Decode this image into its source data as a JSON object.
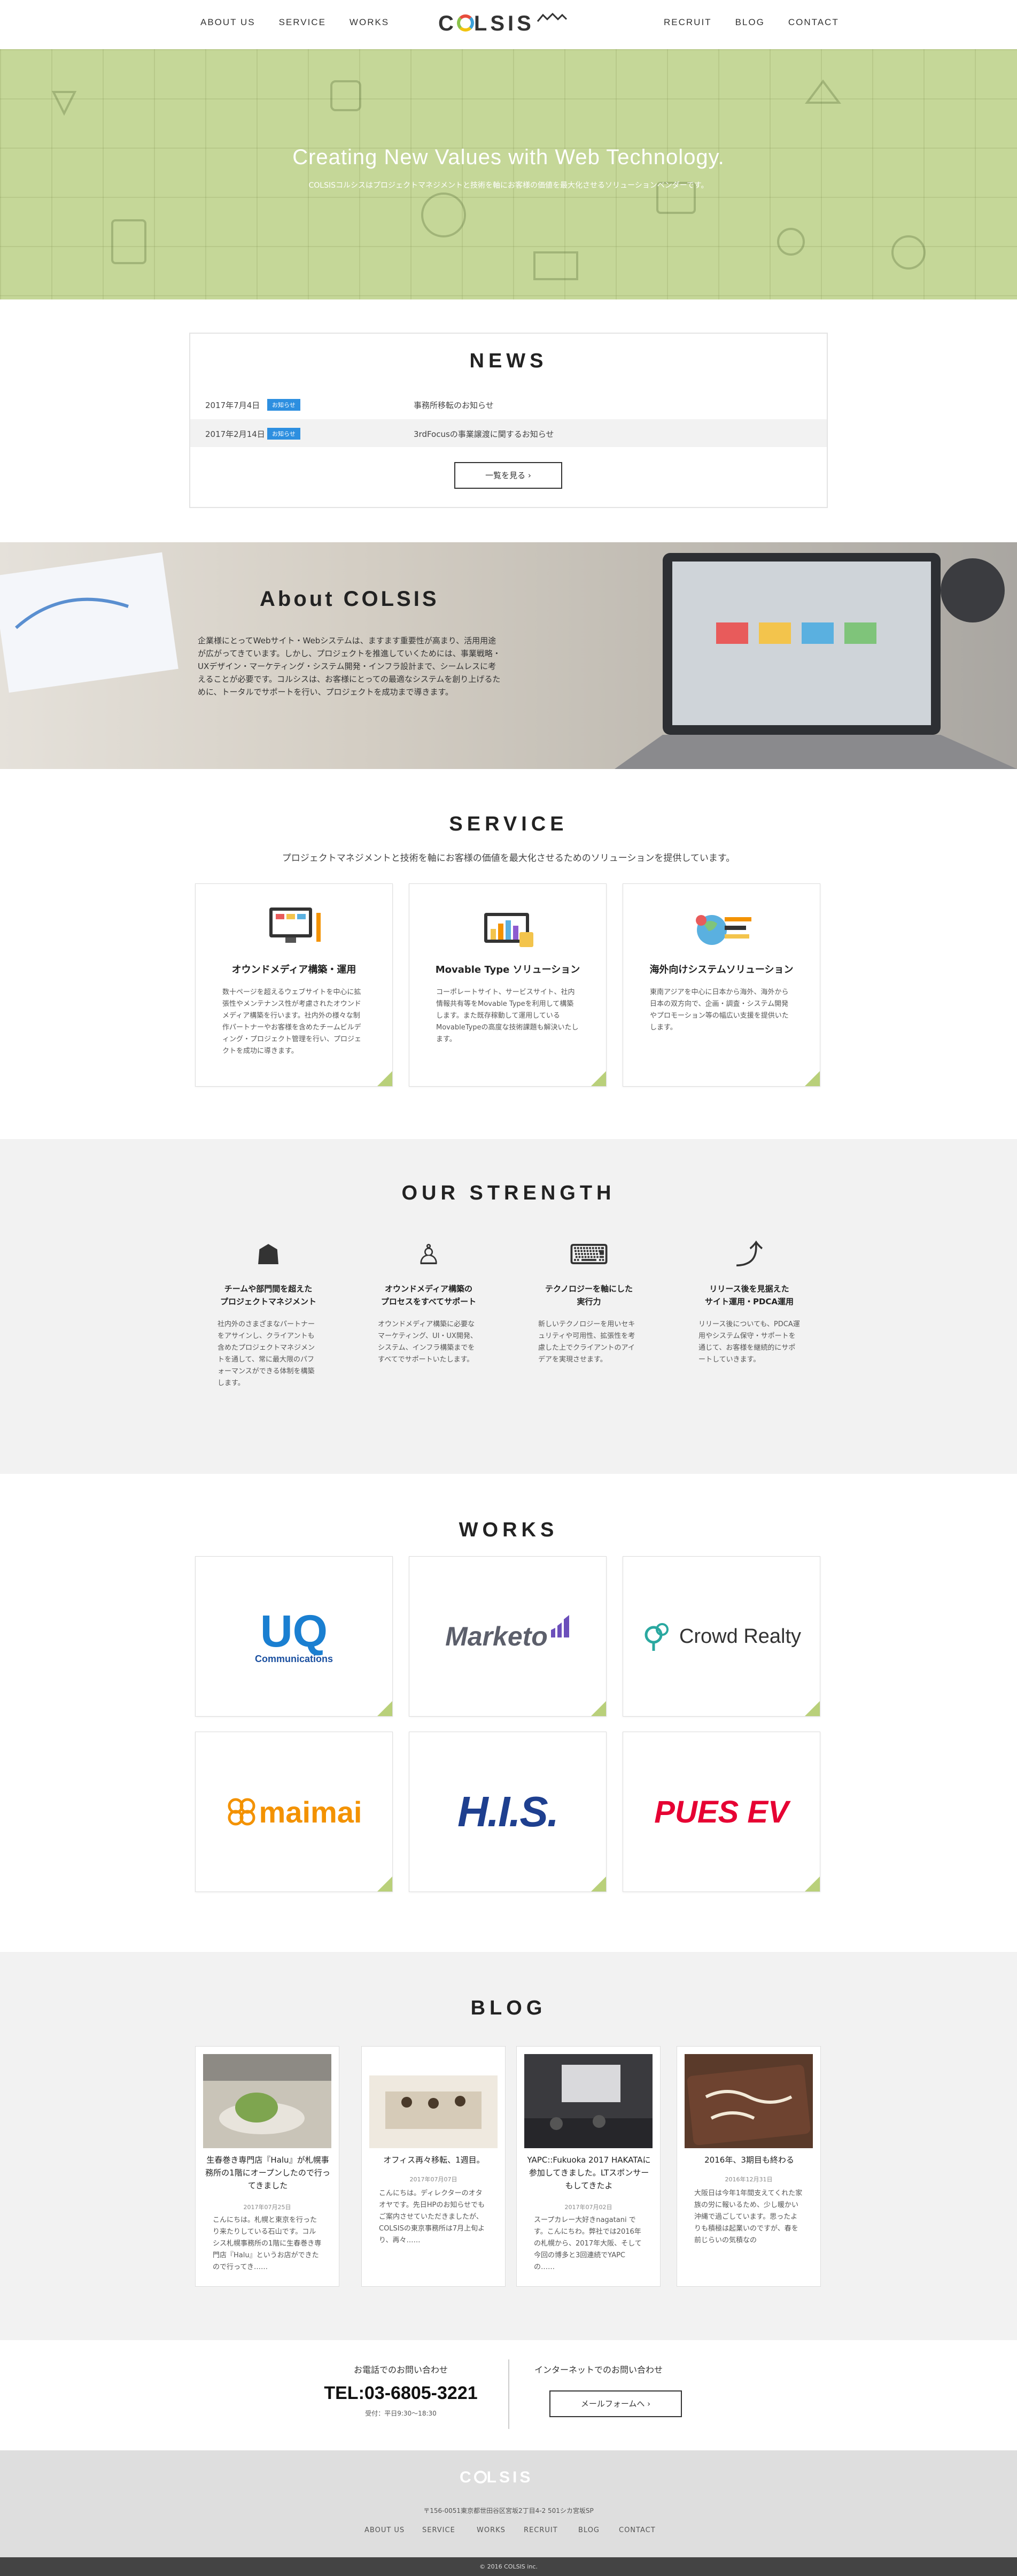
{
  "header": {
    "nav_left": [
      "ABOUT US",
      "SERVICE",
      "WORKS"
    ],
    "nav_right": [
      "RECRUIT",
      "BLOG",
      "CONTACT"
    ],
    "logo": {
      "pre": "C",
      "post": "LSIS"
    }
  },
  "hero": {
    "title": "Creating New Values with Web Technology.",
    "subtitle": "COLSISコルシスはプロジェクトマネジメントと技術を軸にお客様の価値を最大化させるソリューションベンダーです。"
  },
  "news": {
    "title": "NEWS",
    "items": [
      {
        "date": "2017年7月4日",
        "badge": "お知らせ",
        "text": "事務所移転のお知らせ"
      },
      {
        "date": "2017年2月14日",
        "badge": "お知らせ",
        "text": "3rdFocusの事業譲渡に関するお知らせ"
      }
    ],
    "more": "一覧を見る"
  },
  "about": {
    "title": "About COLSIS",
    "body": "企業様にとってWebサイト・Webシステムは、ますます重要性が高まり、活用用途が広がってきています。しかし、プロジェクトを推進していくためには、事業戦略・UXデザイン・マーケティング・システム開発・インフラ設計まで、シームレスに考えることが必要です。コルシスは、お客様にとっての最適なシステムを創り上げるために、トータルでサポートを行い、プロジェクトを成功まで導きます。"
  },
  "service": {
    "title": "SERVICE",
    "lead": "プロジェクトマネジメントと技術を軸にお客様の価値を最大化させるためのソリューションを提供しています。",
    "items": [
      {
        "title": "オウンドメディア構築・運用",
        "body": "数十ページを超えるウェブサイトを中心に拡張性やメンテナンス性が考慮されたオウンドメディア構築を行います。社内外の様々な制作パートナーやお客様を含めたチームビルディング・プロジェクト管理を行い、プロジェクトを成功に導きます。",
        "icon": "media-icon"
      },
      {
        "title": "Movable Type ソリューション",
        "body": "コーポレートサイト、サービスサイト、社内情報共有等をMovable Typeを利用して構築します。また既存稼動して運用しているMovableTypeの高度な技術課題も解決いたします。",
        "icon": "chart-icon"
      },
      {
        "title": "海外向けシステムソリューション",
        "body": "東南アジアを中心に日本から海外、海外から日本の双方向で、企画・調査・システム開発やプロモーション等の幅広い支援を提供いたします。",
        "icon": "globe-icon"
      }
    ]
  },
  "strength": {
    "title": "OUR STRENGTH",
    "items": [
      {
        "title": "チームや部門間を超えた\nプロジェクトマネジメント",
        "body": "社内外のさまざまなパートナーをアサインし、クライアントも含めたプロジェクトマネジメントを通して、常に最大限のパフォーマンスができる体制を構築します。",
        "glyph": "☗"
      },
      {
        "title": "オウンドメディア構築の\nプロセスをすべてサポート",
        "body": "オウンドメディア構築に必要なマーケティング、UI・UX開発、システム、インフラ構築までをすべてでサポートいたします。",
        "glyph": "♙"
      },
      {
        "title": "テクノロジーを軸にした\n実行力",
        "body": "新しいテクノロジーを用いセキュリティや可用性、拡張性を考慮した上でクライアントのアイデアを実現させます。",
        "glyph": "⌨"
      },
      {
        "title": "リリース後を見据えた\nサイト運用・PDCA運用",
        "body": "リリース後についても、PDCA運用やシステム保守・サポートを通じて、お客様を継続的にサポートしていきます。",
        "glyph": "⤴"
      }
    ]
  },
  "works": {
    "title": "WORKS",
    "logos": [
      {
        "name": "UQ",
        "sub": "Communications",
        "color": "#1a7fd1"
      },
      {
        "name": "Marketo",
        "color": "#5c5f6b"
      },
      {
        "name": "Crowd Realty",
        "color": "#333333"
      },
      {
        "name": "maimai",
        "color": "#f39200"
      },
      {
        "name": "H.I.S.",
        "color": "#1e3f8f"
      },
      {
        "name": "PUES EV",
        "color": "#e60033"
      }
    ]
  },
  "blog": {
    "title": "BLOG",
    "posts": [
      {
        "title": "生春巻き専門店『Halu』が札幌事務所の1階にオープンしたので行ってきました",
        "date": "2017年07月25日",
        "excerpt": "こんにちは。札幌と東京を行ったり来たりしている石山です。コルシス札幌事務所の1階に生春巻き専門店『Halu』というお店ができたので行ってき……"
      },
      {
        "title": "オフィス再々移転、1週目。",
        "date": "2017年07月07日",
        "excerpt": "こんにちは。ディレクターのオタオヤです。先日HPのお知らせでもご案内させていただきましたが、COLSISの東京事務所は7月上旬より、再々……"
      },
      {
        "title": "YAPC::Fukuoka 2017 HAKATAに参加してきました。LTスポンサーもしてきたよ",
        "date": "2017年07月02日",
        "excerpt": "スープカレー大好きnagatani です。こんにちわ。弊社では2016年の札幌から、2017年大阪、そして今回の博多と3回連続でYAPCの……"
      },
      {
        "title": "2016年、3期目も終わる",
        "date": "2016年12月31日",
        "excerpt": "大阪日は今年1年間支えてくれた家族の労に報いるため、少し暖かい沖縄で過ごしています。思ったよりも積極は起業いのですが、春を前じらいの気積なの"
      }
    ]
  },
  "contact": {
    "phone_head": "お電話でのお問い合わせ",
    "tel": "TEL:03-6805-3221",
    "hours": "受付：平日9:30〜18:30",
    "net_head": "インターネットでのお問い合わせ",
    "form": "メールフォームへ"
  },
  "footer": {
    "address": "〒156-0051東京都世田谷区宮坂2丁目4-2 501シカ宮坂SP",
    "nav": [
      "ABOUT US",
      "SERVICE",
      "WORKS",
      "RECRUIT",
      "BLOG",
      "CONTACT"
    ],
    "copyright": "© 2016 COLSIS inc."
  }
}
